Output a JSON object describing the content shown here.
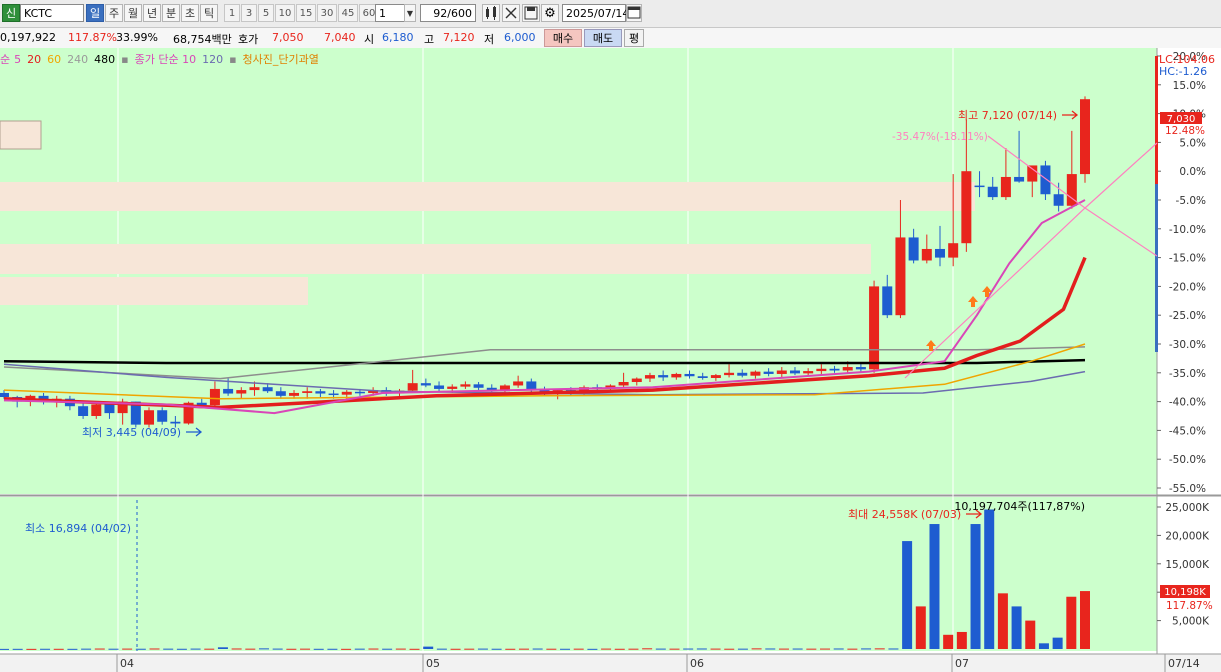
{
  "toolbar": {
    "market_badge": "신",
    "symbol": "KCTC",
    "periods": [
      "일",
      "주",
      "월",
      "년",
      "분",
      "초",
      "틱"
    ],
    "active_period": "일",
    "intervals": [
      "1",
      "3",
      "5",
      "10",
      "15",
      "30",
      "45",
      "60"
    ],
    "interval_value": "1",
    "count": "92",
    "count_total": "/600",
    "date": "2025/07/14"
  },
  "info": {
    "volume": "0,197,922",
    "vol_ratio": "117.87%",
    "turnover": "33.99%",
    "amount": "68,754백만",
    "quote_label": "호가",
    "ask": "7,050",
    "bid": "7,040",
    "open_label": "시",
    "open": "6,180",
    "high_label": "고",
    "high": "7,120",
    "low_label": "저",
    "low": "6,000",
    "buy_label": "매수",
    "sell_label": "매도",
    "eval_label": "평"
  },
  "legend": {
    "ma_prefix": "순",
    "ma5": "5",
    "ma20": "20",
    "ma60": "60",
    "ma240": "240",
    "ma480": "480",
    "close_ma": "종가 단순 10",
    "close_ma120": "120",
    "blue_sky": "청사진_단기과열"
  },
  "colors": {
    "up": "#e8251d",
    "down": "#1e5cd0",
    "bg": "#ccffcc",
    "ma5": "#d946b8",
    "ma20": "#e31e1e",
    "ma60": "#f0a500",
    "ma240": "#6b6bb0",
    "ma480": "#000000"
  },
  "chart_data": [
    {
      "type": "candlestick",
      "x_labels": [
        "04",
        "05",
        "06",
        "07",
        "07/14"
      ],
      "price_axis_pct": [
        "20.0%",
        "15.0%",
        "10.0%",
        "5.0%",
        "0.0%",
        "-5.0%",
        "-10.0%",
        "-15.0%",
        "-20.0%",
        "-25.0%",
        "-30.0%",
        "-35.0%",
        "-40.0%",
        "-45.0%",
        "-50.0%",
        "-55.0%"
      ],
      "pct_range": [
        -55,
        20
      ],
      "last_price": "7,030",
      "last_pct": "12.48%",
      "lc": "LC:104.06",
      "hc": "HC:-1.26",
      "max_label": "최고 7,120 (07/14)",
      "min_label": "최저 3,445 (04/09)",
      "trend_label": "-35.47%(-18.11%)",
      "candles": [
        {
          "o": -38.5,
          "h": -38.0,
          "l": -39.5,
          "c": -39.2
        },
        {
          "o": -39.2,
          "h": -39.0,
          "l": -41.0,
          "c": -40.0
        },
        {
          "o": -40.0,
          "h": -38.8,
          "l": -40.8,
          "c": -39.0
        },
        {
          "o": -39.0,
          "h": -38.5,
          "l": -40.5,
          "c": -39.8
        },
        {
          "o": -39.8,
          "h": -39.0,
          "l": -41.0,
          "c": -39.5
        },
        {
          "o": -39.5,
          "h": -39.0,
          "l": -41.5,
          "c": -40.8
        },
        {
          "o": -40.8,
          "h": -40.0,
          "l": -43.0,
          "c": -42.5
        },
        {
          "o": -42.5,
          "h": -40.0,
          "l": -43.0,
          "c": -40.5
        },
        {
          "o": -40.5,
          "h": -40.0,
          "l": -43.0,
          "c": -42.0
        },
        {
          "o": -42.0,
          "h": -39.5,
          "l": -44.0,
          "c": -40.0
        },
        {
          "o": -40.0,
          "h": -40.0,
          "l": -44.5,
          "c": -44.0
        },
        {
          "o": -44.0,
          "h": -41.0,
          "l": -44.5,
          "c": -41.5
        },
        {
          "o": -41.5,
          "h": -41.0,
          "l": -44.0,
          "c": -43.5
        },
        {
          "o": -43.5,
          "h": -42.5,
          "l": -44.5,
          "c": -43.8
        },
        {
          "o": -43.8,
          "h": -40.0,
          "l": -44.0,
          "c": -40.2
        },
        {
          "o": -40.2,
          "h": -39.5,
          "l": -41.0,
          "c": -40.6
        },
        {
          "o": -40.6,
          "h": -36.5,
          "l": -41.0,
          "c": -37.8
        },
        {
          "o": -37.8,
          "h": -36.0,
          "l": -39.0,
          "c": -38.6
        },
        {
          "o": -38.6,
          "h": -37.5,
          "l": -39.5,
          "c": -38.0
        },
        {
          "o": -38.0,
          "h": -36.5,
          "l": -39.0,
          "c": -37.5
        },
        {
          "o": -37.5,
          "h": -36.8,
          "l": -38.5,
          "c": -38.2
        },
        {
          "o": -38.2,
          "h": -37.5,
          "l": -39.5,
          "c": -39.0
        },
        {
          "o": -39.0,
          "h": -38.0,
          "l": -39.5,
          "c": -38.5
        },
        {
          "o": -38.5,
          "h": -37.5,
          "l": -39.5,
          "c": -38.2
        },
        {
          "o": -38.2,
          "h": -37.8,
          "l": -39.2,
          "c": -38.6
        },
        {
          "o": -38.6,
          "h": -38.0,
          "l": -39.5,
          "c": -38.8
        },
        {
          "o": -38.8,
          "h": -38.0,
          "l": -39.5,
          "c": -38.3
        },
        {
          "o": -38.3,
          "h": -37.8,
          "l": -39.0,
          "c": -38.5
        },
        {
          "o": -38.5,
          "h": -37.5,
          "l": -39.0,
          "c": -38.0
        },
        {
          "o": -38.0,
          "h": -37.5,
          "l": -39.0,
          "c": -38.6
        },
        {
          "o": -38.6,
          "h": -37.8,
          "l": -39.2,
          "c": -38.1
        },
        {
          "o": -38.1,
          "h": -34.5,
          "l": -38.5,
          "c": -36.8
        },
        {
          "o": -36.8,
          "h": -36.0,
          "l": -37.5,
          "c": -37.2
        },
        {
          "o": -37.2,
          "h": -36.5,
          "l": -38.2,
          "c": -37.8
        },
        {
          "o": -37.8,
          "h": -37.0,
          "l": -38.5,
          "c": -37.4
        },
        {
          "o": -37.4,
          "h": -36.5,
          "l": -37.8,
          "c": -37.0
        },
        {
          "o": -37.0,
          "h": -36.6,
          "l": -38.0,
          "c": -37.6
        },
        {
          "o": -37.6,
          "h": -37.0,
          "l": -38.6,
          "c": -38.2
        },
        {
          "o": -38.2,
          "h": -37.0,
          "l": -38.8,
          "c": -37.2
        },
        {
          "o": -37.2,
          "h": -35.5,
          "l": -37.6,
          "c": -36.5
        },
        {
          "o": -36.5,
          "h": -36.0,
          "l": -38.5,
          "c": -38.0
        },
        {
          "o": -38.0,
          "h": -37.4,
          "l": -39.0,
          "c": -38.6
        },
        {
          "o": -38.6,
          "h": -37.8,
          "l": -39.6,
          "c": -38.0
        },
        {
          "o": -38.0,
          "h": -37.5,
          "l": -39.0,
          "c": -38.5
        },
        {
          "o": -38.5,
          "h": -37.2,
          "l": -39.0,
          "c": -37.5
        },
        {
          "o": -37.5,
          "h": -37.0,
          "l": -38.4,
          "c": -37.8
        },
        {
          "o": -37.8,
          "h": -37.0,
          "l": -38.4,
          "c": -37.2
        },
        {
          "o": -37.2,
          "h": -35.0,
          "l": -37.6,
          "c": -36.6
        },
        {
          "o": -36.6,
          "h": -35.8,
          "l": -37.2,
          "c": -36.0
        },
        {
          "o": -36.0,
          "h": -35.0,
          "l": -36.6,
          "c": -35.4
        },
        {
          "o": -35.4,
          "h": -34.6,
          "l": -36.4,
          "c": -35.8
        },
        {
          "o": -35.8,
          "h": -35.0,
          "l": -36.2,
          "c": -35.2
        },
        {
          "o": -35.2,
          "h": -34.6,
          "l": -36.0,
          "c": -35.6
        },
        {
          "o": -35.6,
          "h": -35.0,
          "l": -36.2,
          "c": -35.9
        },
        {
          "o": -35.9,
          "h": -35.2,
          "l": -36.4,
          "c": -35.4
        },
        {
          "o": -35.4,
          "h": -33.5,
          "l": -35.8,
          "c": -35.0
        },
        {
          "o": -35.0,
          "h": -34.4,
          "l": -35.8,
          "c": -35.5
        },
        {
          "o": -35.5,
          "h": -34.6,
          "l": -36.0,
          "c": -34.8
        },
        {
          "o": -34.8,
          "h": -34.2,
          "l": -35.6,
          "c": -35.2
        },
        {
          "o": -35.2,
          "h": -34.0,
          "l": -35.8,
          "c": -34.6
        },
        {
          "o": -34.6,
          "h": -34.0,
          "l": -35.4,
          "c": -35.1
        },
        {
          "o": -35.1,
          "h": -34.2,
          "l": -35.6,
          "c": -34.7
        },
        {
          "o": -34.7,
          "h": -33.5,
          "l": -35.2,
          "c": -34.3
        },
        {
          "o": -34.3,
          "h": -33.8,
          "l": -35.0,
          "c": -34.6
        },
        {
          "o": -34.6,
          "h": -33.0,
          "l": -35.2,
          "c": -34.0
        },
        {
          "o": -34.0,
          "h": -33.2,
          "l": -34.8,
          "c": -34.4
        },
        {
          "o": -34.4,
          "h": -19.0,
          "l": -35.0,
          "c": -20.0
        },
        {
          "o": -20.0,
          "h": -18.0,
          "l": -25.5,
          "c": -25.0
        },
        {
          "o": -25.0,
          "h": -5.0,
          "l": -25.5,
          "c": -11.5
        },
        {
          "o": -11.5,
          "h": -10.0,
          "l": -16.0,
          "c": -15.5
        },
        {
          "o": -15.5,
          "h": -11.0,
          "l": -16.0,
          "c": -13.5
        },
        {
          "o": -13.5,
          "h": -9.5,
          "l": -16.5,
          "c": -15.0
        },
        {
          "o": -15.0,
          "h": -0.5,
          "l": -16.5,
          "c": -12.5
        },
        {
          "o": -12.5,
          "h": 9.0,
          "l": -14.0,
          "c": 0.0
        },
        {
          "o": -2.5,
          "h": 0.0,
          "l": -4.5,
          "c": -2.7
        },
        {
          "o": -2.7,
          "h": -1.0,
          "l": -5.0,
          "c": -4.5
        },
        {
          "o": -4.5,
          "h": 4.0,
          "l": -5.0,
          "c": -1.0
        },
        {
          "o": -1.0,
          "h": 7.0,
          "l": -2.0,
          "c": -1.8
        },
        {
          "o": -1.8,
          "h": 0.5,
          "l": -4.5,
          "c": 1.0
        },
        {
          "o": 1.0,
          "h": 1.8,
          "l": -5.0,
          "c": -4.0
        },
        {
          "o": -4.0,
          "h": -2.0,
          "l": -7.0,
          "c": -6.0
        },
        {
          "o": -6.0,
          "h": 7.0,
          "l": -6.5,
          "c": -0.5
        },
        {
          "o": -0.5,
          "h": 13.0,
          "l": -2.0,
          "c": 12.5
        }
      ],
      "ma_lines": {
        "ma480": [
          [
            0,
            -33.0
          ],
          [
            0.15,
            -33.3
          ],
          [
            0.4,
            -33.3
          ],
          [
            0.7,
            -33.3
          ],
          [
            0.9,
            -33.3
          ],
          [
            1.0,
            -32.8
          ]
        ],
        "ma240": [
          [
            0,
            -33.5
          ],
          [
            0.15,
            -35.8
          ],
          [
            0.35,
            -38.2
          ],
          [
            0.6,
            -38.8
          ],
          [
            0.85,
            -38.5
          ],
          [
            0.95,
            -36.5
          ],
          [
            1.0,
            -34.8
          ]
        ],
        "ma_gray": [
          [
            0,
            -34.0
          ],
          [
            0.2,
            -36.0
          ],
          [
            0.45,
            -31.0
          ],
          [
            0.7,
            -31.0
          ],
          [
            0.9,
            -31.0
          ],
          [
            1.0,
            -30.5
          ]
        ],
        "ma60": [
          [
            0,
            -38.0
          ],
          [
            0.2,
            -39.5
          ],
          [
            0.5,
            -39.0
          ],
          [
            0.75,
            -38.8
          ],
          [
            0.87,
            -37.0
          ],
          [
            0.95,
            -33.0
          ],
          [
            1.0,
            -30.0
          ]
        ],
        "ma20": [
          [
            0,
            -39.5
          ],
          [
            0.2,
            -41.0
          ],
          [
            0.4,
            -39.0
          ],
          [
            0.6,
            -38.0
          ],
          [
            0.8,
            -35.5
          ],
          [
            0.87,
            -34.2
          ],
          [
            0.9,
            -32.0
          ],
          [
            0.94,
            -29.5
          ],
          [
            0.98,
            -24.0
          ],
          [
            1.0,
            -15.0
          ]
        ],
        "ma10": [
          [
            0,
            -39.8
          ],
          [
            0.15,
            -40.5
          ],
          [
            0.25,
            -42.0
          ],
          [
            0.35,
            -38.5
          ],
          [
            0.6,
            -37.5
          ],
          [
            0.8,
            -34.8
          ],
          [
            0.87,
            -33.0
          ],
          [
            0.9,
            -25.0
          ],
          [
            0.93,
            -16.0
          ],
          [
            0.96,
            -9.0
          ],
          [
            1.0,
            -5.0
          ]
        ]
      }
    },
    {
      "type": "bar",
      "series_name": "volume",
      "max_label": "최대 24,558K (07/03)",
      "min_label": "최소 16,894 (04/02)",
      "total_label": "10,197,704주(117,87%)",
      "last_value": "10,198K",
      "last_pct": "117.87%",
      "y_ticks": [
        "25,000K",
        "20,000K",
        "15,000K",
        "10,000K",
        "5,000K"
      ],
      "ylim": [
        0,
        25000
      ],
      "values": [
        20,
        30,
        25,
        40,
        35,
        30,
        60,
        80,
        50,
        70,
        45,
        90,
        60,
        40,
        70,
        55,
        300,
        90,
        60,
        110,
        70,
        40,
        60,
        35,
        40,
        30,
        60,
        80,
        50,
        70,
        35,
        420,
        60,
        40,
        55,
        70,
        45,
        40,
        60,
        80,
        50,
        40,
        60,
        30,
        70,
        40,
        55,
        120,
        70,
        60,
        80,
        90,
        70,
        50,
        60,
        110,
        90,
        70,
        80,
        60,
        75,
        90,
        60,
        100,
        110,
        90,
        19000,
        7500,
        22000,
        2500,
        3000,
        22000,
        24558,
        9800,
        7500,
        5000,
        1000,
        2000,
        9200,
        10198
      ]
    }
  ]
}
